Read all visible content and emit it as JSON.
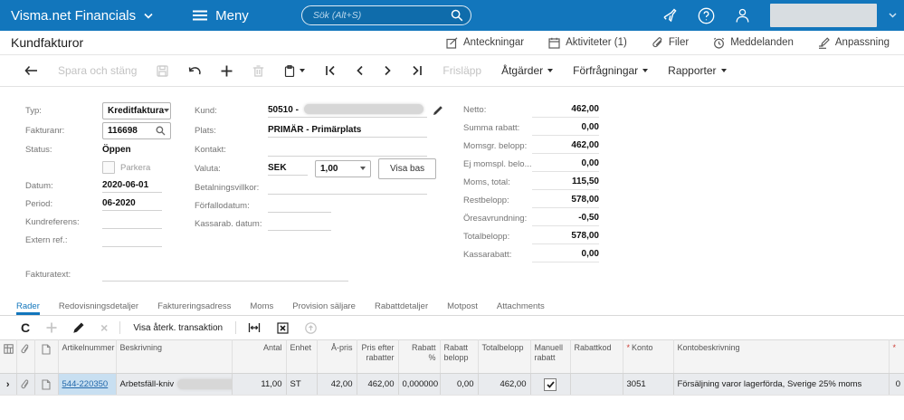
{
  "colors": {
    "accent_blue": "#1276bc",
    "link_blue": "#2268ab",
    "selected_row": "#e9ebee",
    "selected_cell": "#c8dff1",
    "required_red": "#cc3b33"
  },
  "topbar": {
    "app_title": "Visma.net Financials",
    "menu_label": "Meny",
    "search_placeholder": "Sök (Alt+S)",
    "icons": [
      "megaphone-icon",
      "help-icon",
      "user-icon",
      "chevron-down-icon"
    ]
  },
  "page_header": {
    "title": "Kundfakturor",
    "links": [
      {
        "label": "Anteckningar",
        "icon": "note-icon"
      },
      {
        "label": "Aktiviteter (1)",
        "icon": "calendar-icon"
      },
      {
        "label": "Filer",
        "icon": "paperclip-icon"
      },
      {
        "label": "Meddelanden",
        "icon": "alarm-icon"
      },
      {
        "label": "Anpassning",
        "icon": "customize-icon"
      }
    ]
  },
  "toolbar": {
    "save_close_label": "Spara och stäng",
    "release_label": "Frisläpp",
    "actions_label": "Åtgärder",
    "inquiries_label": "Förfrågningar",
    "reports_label": "Rapporter"
  },
  "form": {
    "left": {
      "type_label": "Typ:",
      "type_value": "Kreditfaktura",
      "refnbr_label": "Fakturanr:",
      "refnbr_value": "116698",
      "status_label": "Status:",
      "status_value": "Öppen",
      "hold_label": "Parkera",
      "date_label": "Datum:",
      "date_value": "2020-06-01",
      "period_label": "Period:",
      "period_value": "06-2020",
      "customer_ref_label": "Kundreferens:",
      "external_ref_label": "Extern ref.:",
      "invoice_text_label": "Fakturatext:"
    },
    "middle": {
      "customer_label": "Kund:",
      "customer_value": "50510 -",
      "location_label": "Plats:",
      "location_value": "PRIMÄR - Primärplats",
      "contact_label": "Kontakt:",
      "currency_label": "Valuta:",
      "currency_code": "SEK",
      "currency_rate": "1,00",
      "view_base_label": "Visa bas",
      "terms_label": "Betalningsvillkor:",
      "due_date_label": "Förfallodatum:",
      "cash_discount_date_label": "Kassarab. datum:"
    },
    "totals": [
      {
        "label": "Netto:",
        "value": "462,00"
      },
      {
        "label": "Summa rabatt:",
        "value": "0,00"
      },
      {
        "label": "Momsgr. belopp:",
        "value": "462,00"
      },
      {
        "label": "Ej momspl. belo...",
        "value": "0,00"
      },
      {
        "label": "Moms, total:",
        "value": "115,50"
      },
      {
        "label": "Restbelopp:",
        "value": "578,00"
      },
      {
        "label": "Öresavrundning:",
        "value": "-0,50"
      },
      {
        "label": "Totalbelopp:",
        "value": "578,00"
      },
      {
        "label": "Kassarabatt:",
        "value": "0,00"
      }
    ]
  },
  "tabs": [
    "Rader",
    "Redovisningsdetaljer",
    "Faktureringsadress",
    "Moms",
    "Provision säljare",
    "Rabattdetaljer",
    "Motpost",
    "Attachments"
  ],
  "grid_toolbar": {
    "show_reversing_label": "Visa återk. transaktion"
  },
  "table": {
    "required_marker": "*",
    "columns": [
      {
        "label": "",
        "icon": "grid-settings-icon"
      },
      {
        "label": "",
        "icon": "paperclip-icon"
      },
      {
        "label": "",
        "icon": "document-icon"
      },
      {
        "label": "Artikelnummer"
      },
      {
        "label": "Beskrivning"
      },
      {
        "label": "Antal"
      },
      {
        "label": "Enhet"
      },
      {
        "label": "Å-pris"
      },
      {
        "label": "Pris efter rabatter"
      },
      {
        "label": "Rabatt %"
      },
      {
        "label": "Rabatt belopp"
      },
      {
        "label": "Totalbelopp"
      },
      {
        "label": "Manuell rabatt"
      },
      {
        "label": "Rabattkod"
      },
      {
        "label": "Konto",
        "required": true
      },
      {
        "label": "Kontobeskrivning"
      },
      {
        "label": "",
        "required": true
      }
    ],
    "row": {
      "item_number": "544-220350",
      "description": "Arbetsfäll-kniv",
      "qty": "11,00",
      "uom": "ST",
      "unit_price": "42,00",
      "price_after_discount": "462,00",
      "discount_pct": "0,000000",
      "discount_amount": "0,00",
      "total": "462,00",
      "manual_discount_checked": true,
      "discount_code": "",
      "account": "3051",
      "account_description": "Försäljning varor lagerförda, Sverige 25% moms",
      "last_value": "0"
    }
  }
}
